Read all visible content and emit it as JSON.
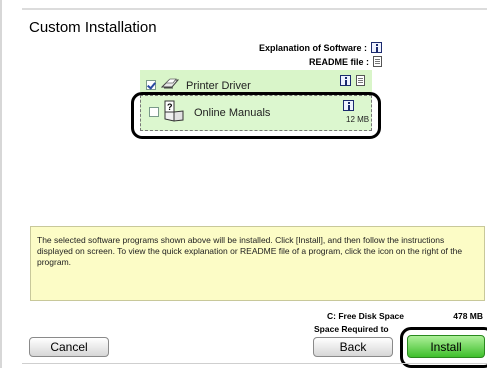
{
  "window": {
    "title": "Custom Installation"
  },
  "legend": {
    "explanation_label": "Explanation of Software :",
    "explanation_icon": "info-icon",
    "readme_label": "README file :",
    "readme_icon": "readme-doc-icon"
  },
  "software_list": [
    {
      "label": "Printer Driver",
      "checked": true,
      "icon": "printer-icon",
      "size": ""
    },
    {
      "label": "Online Manuals",
      "checked": false,
      "icon": "manual-icon",
      "size": "12 MB"
    }
  ],
  "description": "The selected software programs shown above will be installed. Click [Install], and then follow the instructions displayed on screen. To view the quick explanation or README file of a program, click the icon on the right of the program.",
  "disk": {
    "free_label": "C: Free Disk Space",
    "free_value": "478 MB",
    "required_label": "Space Required to"
  },
  "buttons": {
    "cancel": "Cancel",
    "back": "Back",
    "install": "Install"
  },
  "colors": {
    "item_bg": "#d9f5c9",
    "desc_bg": "#fcfcc6",
    "install_bg": "#3fbf2c",
    "annotation": "#000000"
  }
}
